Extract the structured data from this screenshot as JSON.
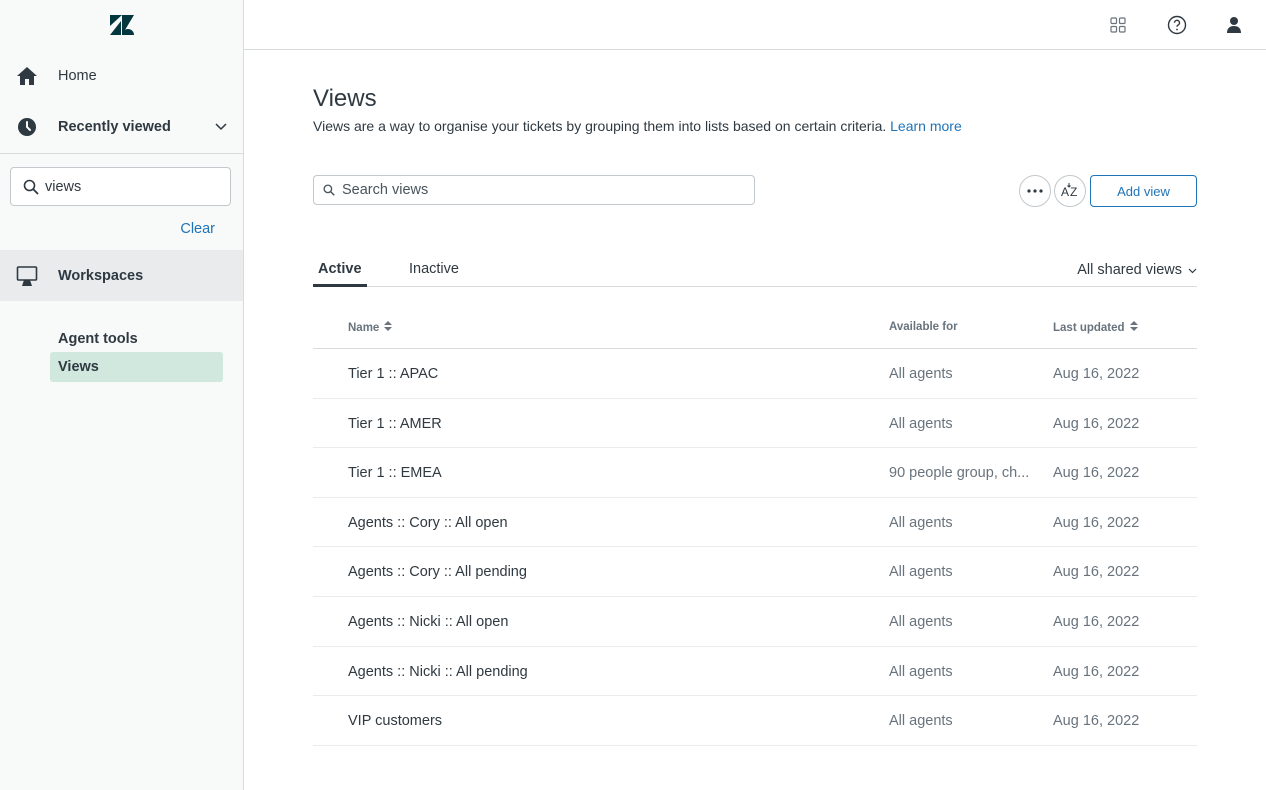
{
  "sidebar": {
    "nav": {
      "home": "Home",
      "recently_viewed": "Recently viewed",
      "workspaces": "Workspaces"
    },
    "search": {
      "value": "views"
    },
    "clear_label": "Clear",
    "sub_items": [
      "Agent tools",
      "Views"
    ]
  },
  "topbar": {
    "icons": [
      "apps-grid-icon",
      "help-icon",
      "user-icon"
    ]
  },
  "main": {
    "title": "Views",
    "description": "Views are a way to organise your tickets by grouping them into lists based on certain criteria.",
    "learn_more": "Learn more",
    "search_placeholder": "Search views",
    "add_view": "Add view",
    "tabs": {
      "active": "Active",
      "inactive": "Inactive"
    },
    "filter": "All shared views",
    "table": {
      "headers": {
        "name": "Name",
        "available_for": "Available for",
        "last_updated": "Last updated"
      },
      "rows": [
        {
          "name": "Tier 1 :: APAC",
          "available_for": "All agents",
          "last_updated": "Aug 16, 2022"
        },
        {
          "name": "Tier 1 :: AMER",
          "available_for": "All agents",
          "last_updated": "Aug 16, 2022"
        },
        {
          "name": "Tier 1 :: EMEA",
          "available_for": "90 people group, ch...",
          "last_updated": "Aug 16, 2022"
        },
        {
          "name": "Agents :: Cory :: All open",
          "available_for": "All agents",
          "last_updated": "Aug 16, 2022"
        },
        {
          "name": "Agents :: Cory :: All pending",
          "available_for": "All agents",
          "last_updated": "Aug 16, 2022"
        },
        {
          "name": "Agents :: Nicki :: All open",
          "available_for": "All agents",
          "last_updated": "Aug 16, 2022"
        },
        {
          "name": "Agents :: Nicki :: All pending",
          "available_for": "All agents",
          "last_updated": "Aug 16, 2022"
        },
        {
          "name": "VIP customers",
          "available_for": "All agents",
          "last_updated": "Aug 16, 2022"
        }
      ]
    }
  },
  "colors": {
    "link": "#1f73b7",
    "text": "#2f3941",
    "muted": "#68737d",
    "selected_bg": "#d1e8df"
  }
}
